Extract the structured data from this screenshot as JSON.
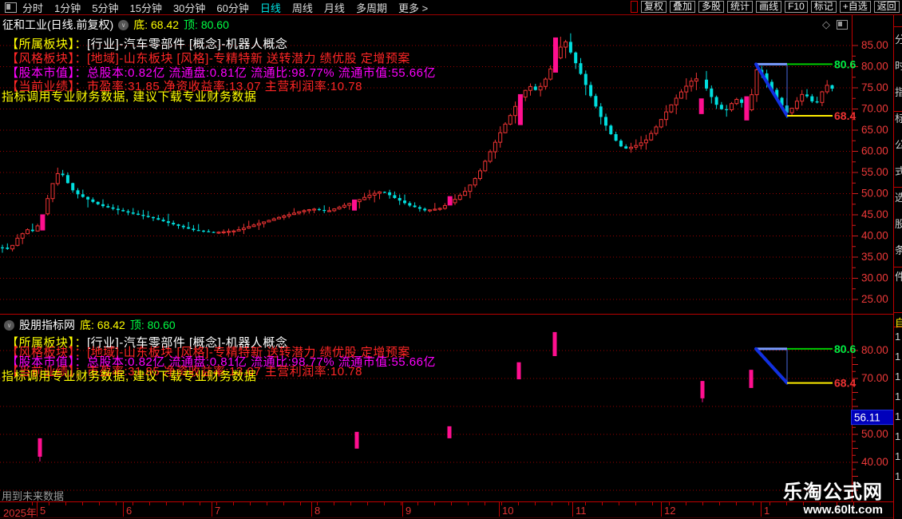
{
  "icons": {
    "chevron_down": "∨",
    "diamond": "◇"
  },
  "window": {
    "toolbar": {
      "periods": [
        "分时",
        "1分钟",
        "5分钟",
        "15分钟",
        "30分钟",
        "60分钟",
        "日线",
        "周线",
        "月线",
        "多周期",
        "更多 >"
      ],
      "active_period": "日线",
      "right_buttons": [
        "复权",
        "叠加",
        "多股",
        "统计",
        "画线",
        "F10",
        "标记",
        "+自选",
        "返回"
      ]
    },
    "main_panel": {
      "title": "征和工业(日线.前复权)",
      "bottom_label": "底:",
      "bottom_value": "68.42",
      "top_label": "顶:",
      "top_value": "80.60"
    },
    "indicator_panel": {
      "title": "股朋指标网",
      "bottom_label": "底:",
      "bottom_value": "68.42",
      "top_label": "顶:",
      "top_value": "80.60",
      "current_value": "56.11"
    },
    "annotations": [
      {
        "label": "【所属板块】：",
        "text": "[行业]-汽车零部件 [概念]-机器人概念",
        "label_color": "#ffff00",
        "text_color": "#ffffff"
      },
      {
        "label": "【风格板块】：",
        "text": "[地域]-山东板块 [风格]-专精特新 送转潜力 绩优股 定增预案",
        "label_color": "#ff2626",
        "text_color": "#ff2626"
      },
      {
        "label": "【股本市值】：",
        "text": "总股本:0.82亿 流通盘:0.81亿 流通比:98.77% 流通市值:55.66亿",
        "label_color": "#ff00ff",
        "text_color": "#ff00ff"
      },
      {
        "label": "【当前业绩】：",
        "text": "市盈率:31.85 净资收益率:13.07 主营利润率:10.78",
        "label_color": "#ff2626",
        "text_color": "#ff2626"
      },
      {
        "label": "",
        "text": "指标调用专业财务数据, 建议下载专业财务数据",
        "label_color": "#ffff00",
        "text_color": "#ffff00"
      }
    ],
    "footer": {
      "note": "用到未来数据",
      "year": "2025年",
      "watermark_line1": "乐淘公式网",
      "watermark_line2": "www.60lt.com"
    },
    "right_strip": {
      "chars": "分时指标公式选股条件",
      "highlight_char": "自",
      "digit": "1",
      "digit_count": 8
    }
  },
  "chart_data": {
    "type": "candlestick",
    "colors": {
      "up": "#ee3333",
      "down": "#00dede",
      "signal": "#ff0f8f",
      "grid": "#9a0000",
      "axis": "#c00000",
      "axis_text": "#ee3939"
    },
    "x_axis": {
      "months": [
        [
          "5",
          50
        ],
        [
          "6",
          158
        ],
        [
          "7",
          269
        ],
        [
          "8",
          394
        ],
        [
          "9",
          508
        ],
        [
          "10",
          629
        ],
        [
          "11",
          721
        ],
        [
          "12",
          832
        ],
        [
          "1",
          957
        ]
      ]
    },
    "main": {
      "ylim": [
        25,
        85
      ],
      "axis_ticks": [
        [
          "85.00",
          85
        ],
        [
          "80.00",
          80
        ],
        [
          "75.00",
          75
        ],
        [
          "70.00",
          70
        ],
        [
          "65.00",
          65
        ],
        [
          "60.00",
          60
        ],
        [
          "55.00",
          55
        ],
        [
          "50.00",
          50
        ],
        [
          "45.00",
          45
        ],
        [
          "40.00",
          40
        ],
        [
          "35.00",
          35
        ],
        [
          "30.00",
          30
        ],
        [
          "25.00",
          25
        ]
      ],
      "grid_values": [
        85,
        80,
        75,
        70,
        65,
        60,
        55,
        50,
        45,
        40,
        35,
        30,
        25
      ],
      "close_keypoints": [
        [
          2,
          37.3
        ],
        [
          12,
          36.8
        ],
        [
          22,
          39.5
        ],
        [
          34,
          41.5
        ],
        [
          44,
          41.0
        ],
        [
          53,
          45.0
        ],
        [
          60,
          49.0
        ],
        [
          68,
          53.5
        ],
        [
          75,
          55.5
        ],
        [
          83,
          53.0
        ],
        [
          93,
          50.3
        ],
        [
          108,
          48.8
        ],
        [
          126,
          47.2
        ],
        [
          146,
          46.2
        ],
        [
          168,
          45.2
        ],
        [
          192,
          44.2
        ],
        [
          216,
          42.8
        ],
        [
          242,
          41.4
        ],
        [
          268,
          40.8
        ],
        [
          294,
          41.2
        ],
        [
          320,
          42.7
        ],
        [
          346,
          44.2
        ],
        [
          374,
          45.7
        ],
        [
          392,
          46.4
        ],
        [
          410,
          45.8
        ],
        [
          428,
          47.0
        ],
        [
          447,
          48.3
        ],
        [
          466,
          49.9
        ],
        [
          479,
          50.6
        ],
        [
          495,
          48.9
        ],
        [
          513,
          47.2
        ],
        [
          533,
          46.0
        ],
        [
          551,
          46.5
        ],
        [
          567,
          48.2
        ],
        [
          583,
          50.6
        ],
        [
          599,
          54.5
        ],
        [
          613,
          59.5
        ],
        [
          627,
          64.5
        ],
        [
          641,
          69.0
        ],
        [
          653,
          73.2
        ],
        [
          663,
          75.5
        ],
        [
          673,
          74.2
        ],
        [
          685,
          77.5
        ],
        [
          697,
          82.5
        ],
        [
          707,
          86.5
        ],
        [
          717,
          82.5
        ],
        [
          727,
          78.5
        ],
        [
          739,
          73.5
        ],
        [
          753,
          68.0
        ],
        [
          767,
          63.5
        ],
        [
          781,
          60.5
        ],
        [
          795,
          61.2
        ],
        [
          809,
          62.6
        ],
        [
          823,
          66.0
        ],
        [
          837,
          70.0
        ],
        [
          851,
          73.5
        ],
        [
          865,
          76.5
        ],
        [
          877,
          77.5
        ],
        [
          889,
          73.5
        ],
        [
          901,
          70.0
        ],
        [
          911,
          69.8
        ],
        [
          921,
          72.5
        ],
        [
          931,
          71.2
        ],
        [
          937,
          69.3
        ],
        [
          943,
          74.5
        ],
        [
          949,
          80.2
        ],
        [
          957,
          77.5
        ],
        [
          967,
          74.5
        ],
        [
          977,
          71.5
        ],
        [
          987,
          68.8
        ],
        [
          997,
          71.5
        ],
        [
          1007,
          74.0
        ],
        [
          1015,
          72.0
        ],
        [
          1023,
          71.3
        ],
        [
          1031,
          74.5
        ],
        [
          1039,
          76.2
        ],
        [
          1047,
          73.0
        ]
      ],
      "signals": [
        [
          53,
          45.1,
          41.3
        ],
        [
          447,
          48.6,
          46.0
        ],
        [
          563,
          49.4,
          47.2
        ],
        [
          651,
          73.5,
          66.2
        ],
        [
          698,
          86.9,
          78.6
        ],
        [
          879,
          72.5,
          68.8
        ],
        [
          933,
          73.0,
          67.3
        ]
      ],
      "levels": {
        "top": {
          "value": 80.6,
          "label": "80.6"
        },
        "bottom": {
          "value": 68.4,
          "label": "68.4"
        },
        "x_start": 947,
        "x_mid": 986,
        "x_end": 1043
      }
    },
    "indicator": {
      "axis_ticks": [
        [
          "80.00",
          80
        ],
        [
          "70.00",
          70
        ],
        [
          "50.00",
          50
        ],
        [
          "40.00",
          40
        ]
      ],
      "grid_values": [
        80,
        70,
        60,
        50,
        40,
        30
      ],
      "bars": [
        [
          50,
          48.6,
          42.0,
          40.3
        ],
        [
          447,
          50.9,
          44.9
        ],
        [
          563,
          52.9,
          48.6
        ],
        [
          650,
          75.8,
          69.7
        ],
        [
          695,
          86.6,
          78.0
        ],
        [
          880,
          69.1,
          62.9,
          61.5
        ],
        [
          941,
          73.1,
          66.6
        ]
      ],
      "current_value": 56.11,
      "levels": {
        "top": {
          "value": 80.6,
          "label": "80.6"
        },
        "bottom": {
          "value": 68.4,
          "label": "68.4"
        },
        "x_start": 947,
        "x_mid": 986,
        "x_end": 1043
      }
    }
  }
}
